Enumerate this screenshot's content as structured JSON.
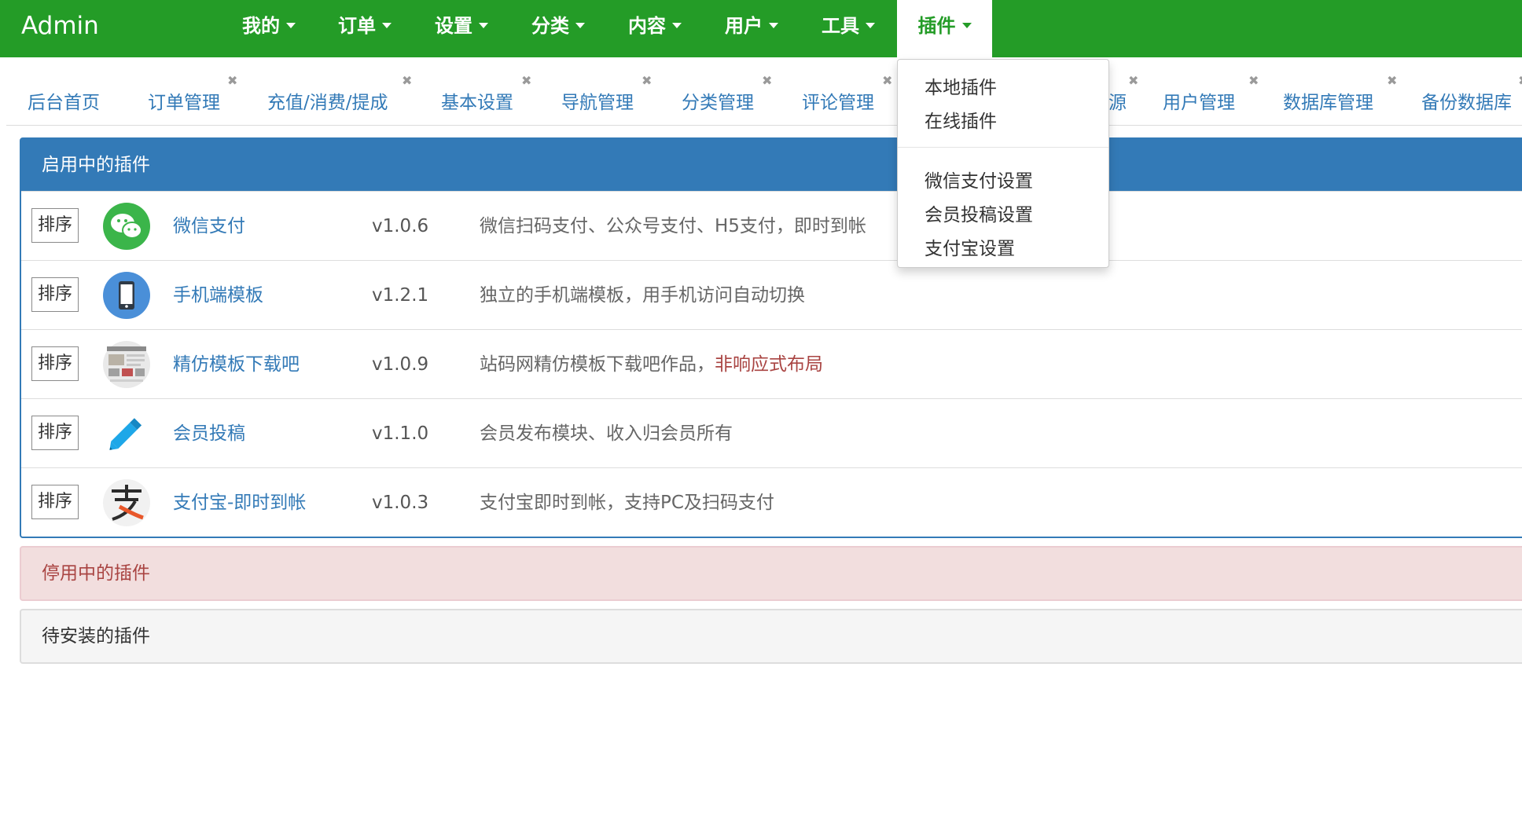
{
  "brand": "Admin",
  "nav": [
    {
      "label": "我的"
    },
    {
      "label": "订单"
    },
    {
      "label": "设置"
    },
    {
      "label": "分类"
    },
    {
      "label": "内容"
    },
    {
      "label": "用户"
    },
    {
      "label": "工具"
    },
    {
      "label": "插件",
      "active": true
    }
  ],
  "tabs": [
    {
      "label": "后台首页",
      "closable": false
    },
    {
      "label": "订单管理",
      "closable": true
    },
    {
      "label": "充值/消费/提成",
      "closable": true
    },
    {
      "label": "基本设置",
      "closable": true
    },
    {
      "label": "导航管理",
      "closable": true
    },
    {
      "label": "分类管理",
      "closable": true
    },
    {
      "label": "评论管理",
      "closable": true
    },
    {
      "label": "源",
      "closable": true
    },
    {
      "label": "用户管理",
      "closable": true
    },
    {
      "label": "数据库管理",
      "closable": true
    },
    {
      "label": "备份数据库",
      "closable": true
    }
  ],
  "tab_close_glyph": "✖",
  "panels": {
    "enabled": {
      "title": "启用中的插件"
    },
    "disabled": {
      "title": "停用中的插件"
    },
    "pending": {
      "title": "待安装的插件"
    }
  },
  "sort_label": "排序",
  "plugins": [
    {
      "icon": "wechat-icon",
      "name": "微信支付",
      "version": "v1.0.6",
      "desc": "微信扫码支付、公众号支付、H5支付，即时到帐",
      "desc_warn": ""
    },
    {
      "icon": "mobile-phone-icon",
      "name": "手机端模板",
      "version": "v1.2.1",
      "desc": "独立的手机端模板，用手机访问自动切换",
      "desc_warn": ""
    },
    {
      "icon": "template-thumbnail-icon",
      "name": "精仿模板下载吧",
      "version": "v1.0.9",
      "desc": "站码网精仿模板下载吧作品，",
      "desc_warn": "非响应式布局"
    },
    {
      "icon": "pencil-icon",
      "name": "会员投稿",
      "version": "v1.1.0",
      "desc": "会员发布模块、收入归会员所有",
      "desc_warn": ""
    },
    {
      "icon": "alipay-icon",
      "name": "支付宝-即时到帐",
      "version": "v1.0.3",
      "desc": "支付宝即时到帐，支持PC及扫码支付",
      "desc_warn": ""
    }
  ],
  "dropdown": {
    "group1": [
      "本地插件",
      "在线插件"
    ],
    "group2": [
      "微信支付设置",
      "会员投稿设置",
      "支付宝设置"
    ]
  },
  "colors": {
    "navbar": "#249c27",
    "primary": "#337ab7",
    "danger_text": "#a94442",
    "danger_bg": "#f2dede"
  }
}
